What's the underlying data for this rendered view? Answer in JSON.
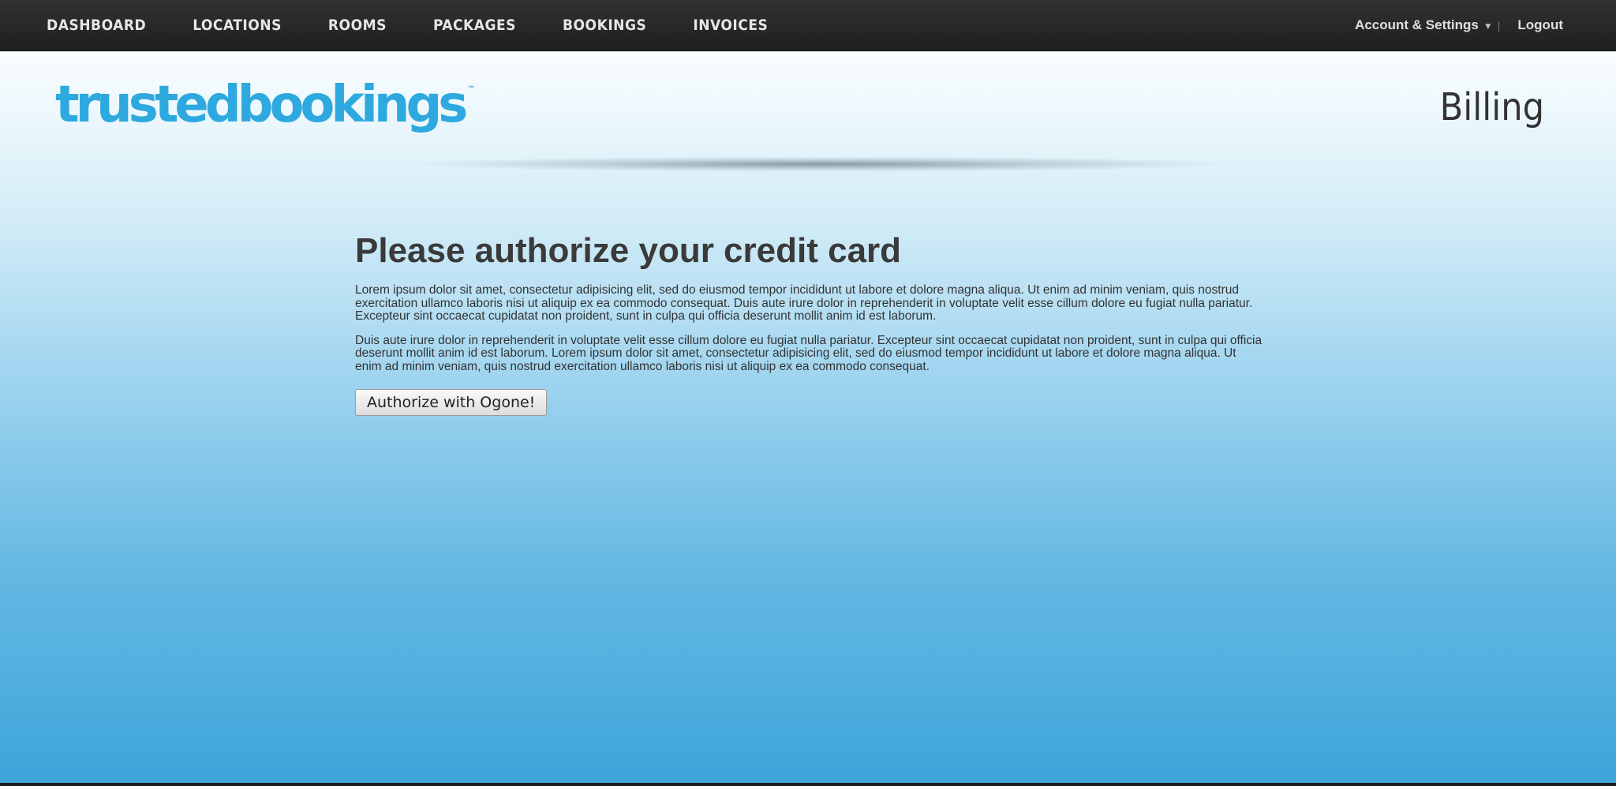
{
  "nav": {
    "items": [
      "DASHBOARD",
      "LOCATIONS",
      "ROOMS",
      "PACKAGES",
      "BOOKINGS",
      "INVOICES"
    ],
    "account_label": "Account & Settings",
    "separator": "|",
    "logout_label": "Logout"
  },
  "header": {
    "logo_text": "trustedbookings",
    "logo_tm": "™",
    "page_title": "Billing"
  },
  "main": {
    "heading": "Please authorize your credit card",
    "paragraph1": "Lorem ipsum dolor sit amet, consectetur adipisicing elit, sed do eiusmod tempor incididunt ut labore et dolore magna aliqua. Ut enim ad minim veniam, quis nostrud exercitation ullamco laboris nisi ut aliquip ex ea commodo consequat. Duis aute irure dolor in reprehenderit in voluptate velit esse cillum dolore eu fugiat nulla pariatur. Excepteur sint occaecat cupidatat non proident, sunt in culpa qui officia deserunt mollit anim id est laborum.",
    "paragraph2": "Duis aute irure dolor in reprehenderit in voluptate velit esse cillum dolore eu fugiat nulla pariatur. Excepteur sint occaecat cupidatat non proident, sunt in culpa qui officia deserunt mollit anim id est laborum. Lorem ipsum dolor sit amet, consectetur adipisicing elit, sed do eiusmod tempor incididunt ut labore et dolore magna aliqua. Ut enim ad minim veniam, quis nostrud exercitation ullamco laboris nisi ut aliquip ex ea commodo consequat.",
    "authorize_button": "Authorize with Ogone!"
  },
  "colors": {
    "brand": "#2ea9df",
    "topbar": "#262626"
  }
}
